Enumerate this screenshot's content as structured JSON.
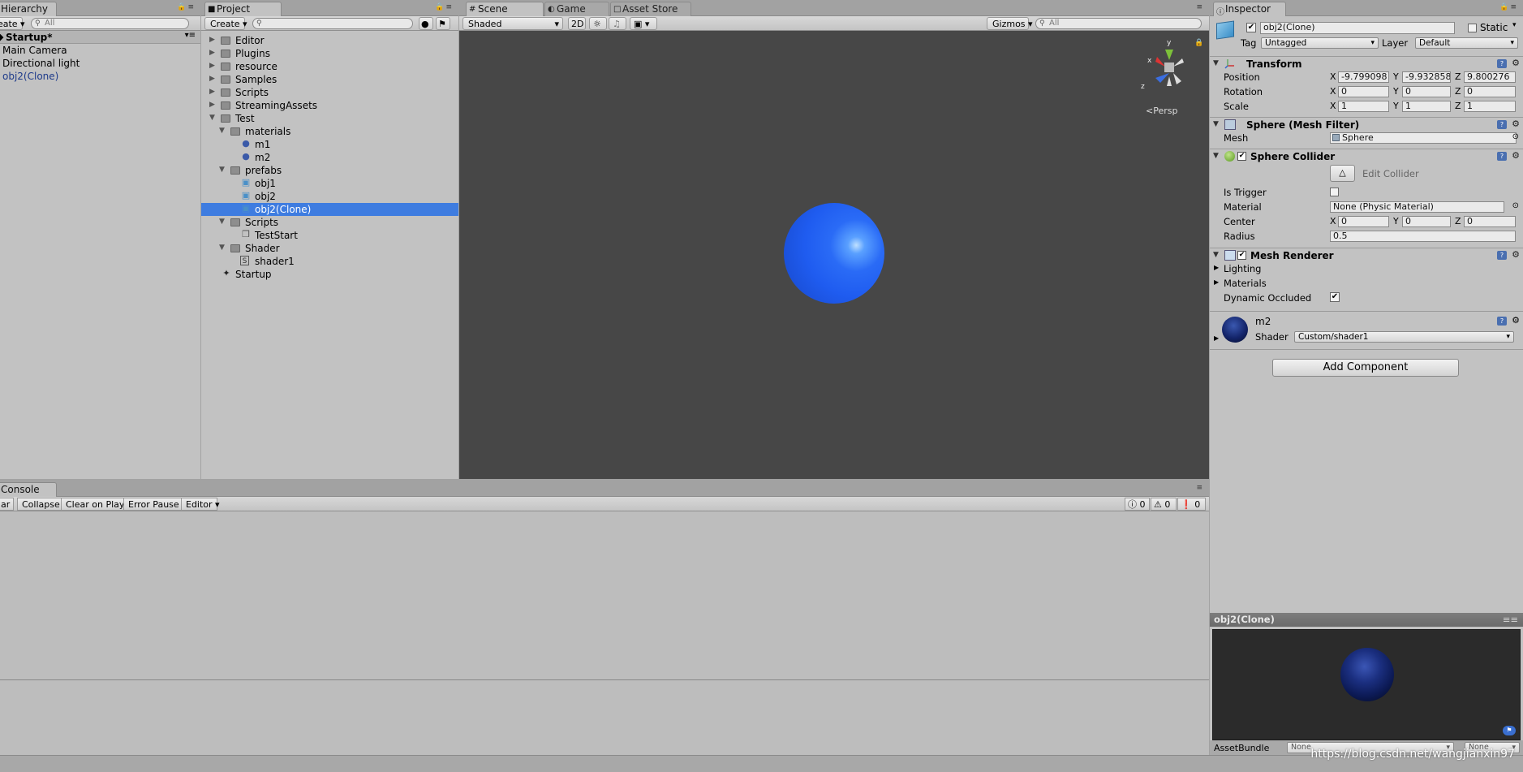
{
  "hierarchy": {
    "tab_label": "Hierarchy",
    "create_label": "Create",
    "search_placeholder": "All",
    "scene_name": "Startup*",
    "items": [
      "Main Camera",
      "Directional light",
      "obj2(Clone)"
    ]
  },
  "project": {
    "tab_label": "Project",
    "create_label": "Create",
    "tree": [
      {
        "label": "Editor",
        "depth": 0,
        "type": "folder",
        "expanded": false
      },
      {
        "label": "Plugins",
        "depth": 0,
        "type": "folder",
        "expanded": false
      },
      {
        "label": "resource",
        "depth": 0,
        "type": "folder",
        "expanded": false
      },
      {
        "label": "Samples",
        "depth": 0,
        "type": "folder",
        "expanded": false
      },
      {
        "label": "Scripts",
        "depth": 0,
        "type": "folder",
        "expanded": false
      },
      {
        "label": "StreamingAssets",
        "depth": 0,
        "type": "folder",
        "expanded": false
      },
      {
        "label": "Test",
        "depth": 0,
        "type": "folder",
        "expanded": true
      },
      {
        "label": "materials",
        "depth": 1,
        "type": "folder",
        "expanded": true
      },
      {
        "label": "m1",
        "depth": 2,
        "type": "material"
      },
      {
        "label": "m2",
        "depth": 2,
        "type": "material"
      },
      {
        "label": "prefabs",
        "depth": 1,
        "type": "folder",
        "expanded": true
      },
      {
        "label": "obj1",
        "depth": 2,
        "type": "prefab"
      },
      {
        "label": "obj2",
        "depth": 2,
        "type": "prefab"
      },
      {
        "label": "obj2(Clone)",
        "depth": 2,
        "type": "prefab",
        "selected": true
      },
      {
        "label": "Scripts",
        "depth": 1,
        "type": "folder",
        "expanded": true
      },
      {
        "label": "TestStart",
        "depth": 2,
        "type": "script"
      },
      {
        "label": "Shader",
        "depth": 1,
        "type": "folder",
        "expanded": true
      },
      {
        "label": "shader1",
        "depth": 2,
        "type": "shader"
      },
      {
        "label": "Startup",
        "depth": 0,
        "type": "scene"
      }
    ]
  },
  "scene": {
    "tabs": [
      "Scene",
      "Game",
      "Asset Store"
    ],
    "shading_mode": "Shaded",
    "mode_2d": "2D",
    "gizmos_label": "Gizmos",
    "search_placeholder": "All",
    "persp_label": "Persp",
    "gizmo_axes": [
      "y",
      "x",
      "z"
    ]
  },
  "console": {
    "tab_label": "Console",
    "buttons": [
      "ar",
      "Collapse",
      "Clear on Play",
      "Error Pause",
      "Editor"
    ],
    "counts": {
      "info": "0",
      "warn": "0",
      "error": "0"
    }
  },
  "inspector": {
    "tab_label": "Inspector",
    "object_name": "obj2(Clone)",
    "static_label": "Static",
    "tag_label": "Tag",
    "tag_value": "Untagged",
    "layer_label": "Layer",
    "layer_value": "Default",
    "transform": {
      "title": "Transform",
      "position_label": "Position",
      "rotation_label": "Rotation",
      "scale_label": "Scale",
      "position": {
        "x": "-9.799098",
        "y": "-9.932858",
        "z": "9.800276"
      },
      "rotation": {
        "x": "0",
        "y": "0",
        "z": "0"
      },
      "scale": {
        "x": "1",
        "y": "1",
        "z": "1"
      }
    },
    "mesh_filter": {
      "title": "Sphere (Mesh Filter)",
      "mesh_label": "Mesh",
      "mesh_value": "Sphere"
    },
    "sphere_collider": {
      "title": "Sphere Collider",
      "edit_label": "Edit Collider",
      "is_trigger_label": "Is Trigger",
      "material_label": "Material",
      "material_value": "None (Physic Material)",
      "center_label": "Center",
      "center": {
        "x": "0",
        "y": "0",
        "z": "0"
      },
      "radius_label": "Radius",
      "radius_value": "0.5"
    },
    "mesh_renderer": {
      "title": "Mesh Renderer",
      "lighting_label": "Lighting",
      "materials_label": "Materials",
      "dynamic_occluded_label": "Dynamic Occluded"
    },
    "material": {
      "name": "m2",
      "shader_label": "Shader",
      "shader_value": "Custom/shader1"
    },
    "add_component_label": "Add Component",
    "preview_title": "obj2(Clone)",
    "assetbundle_label": "AssetBundle",
    "assetbundle_value": "None",
    "assetbundle_variant": "None"
  },
  "watermark": "https://blog.csdn.net/wangjianxin97",
  "colors": {
    "selection": "#3e7ce0",
    "sphere": "#1f5cf0",
    "preview_sphere": "#0c1a55"
  }
}
